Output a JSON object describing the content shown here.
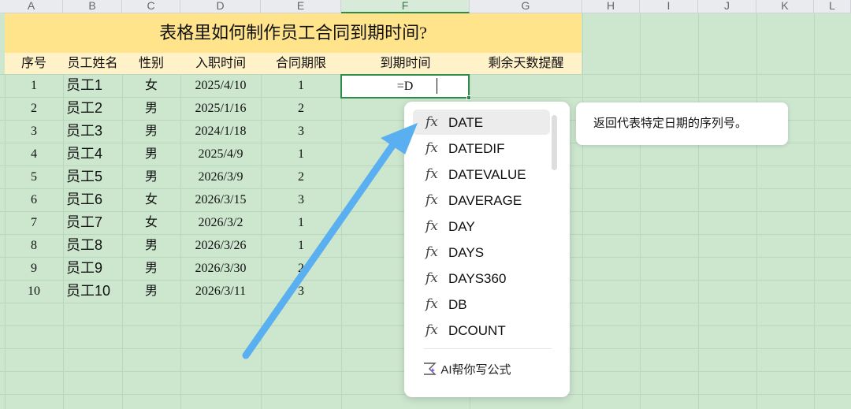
{
  "column_headers": [
    "A",
    "B",
    "C",
    "D",
    "E",
    "F",
    "G",
    "H",
    "I",
    "J",
    "K",
    "L"
  ],
  "title": "表格里如何制作员工合同到期时间?",
  "table_headers": [
    "序号",
    "员工姓名",
    "性别",
    "入职时间",
    "合同期限",
    "到期时间",
    "剩余天数提醒"
  ],
  "rows": [
    {
      "no": "1",
      "name": "员工1",
      "gender": "女",
      "date": "2025/4/10",
      "term": "1"
    },
    {
      "no": "2",
      "name": "员工2",
      "gender": "男",
      "date": "2025/1/16",
      "term": "2"
    },
    {
      "no": "3",
      "name": "员工3",
      "gender": "男",
      "date": "2024/1/18",
      "term": "3"
    },
    {
      "no": "4",
      "name": "员工4",
      "gender": "男",
      "date": "2025/4/9",
      "term": "1"
    },
    {
      "no": "5",
      "name": "员工5",
      "gender": "男",
      "date": "2026/3/9",
      "term": "2"
    },
    {
      "no": "6",
      "name": "员工6",
      "gender": "女",
      "date": "2026/3/15",
      "term": "3"
    },
    {
      "no": "7",
      "name": "员工7",
      "gender": "女",
      "date": "2026/3/2",
      "term": "1"
    },
    {
      "no": "8",
      "name": "员工8",
      "gender": "男",
      "date": "2026/3/26",
      "term": "1"
    },
    {
      "no": "9",
      "name": "员工9",
      "gender": "男",
      "date": "2026/3/30",
      "term": "2"
    },
    {
      "no": "10",
      "name": "员工10",
      "gender": "男",
      "date": "2026/3/11",
      "term": "3"
    }
  ],
  "active_cell_value": "=D",
  "autocomplete": {
    "items": [
      "DATE",
      "DATEDIF",
      "DATEVALUE",
      "DAVERAGE",
      "DAY",
      "DAYS",
      "DAYS360",
      "DB",
      "DCOUNT"
    ],
    "selected_index": 0,
    "fx_symbol": "fx",
    "ai_label": "AI帮你写公式",
    "tooltip": "返回代表特定日期的序列号。"
  },
  "colors": {
    "sheet_background": "#cde7cf",
    "title_fill": "#ffe48b",
    "header_fill": "#fff2c8",
    "active_border": "#2e8b4a",
    "arrow": "#5aaff0"
  }
}
